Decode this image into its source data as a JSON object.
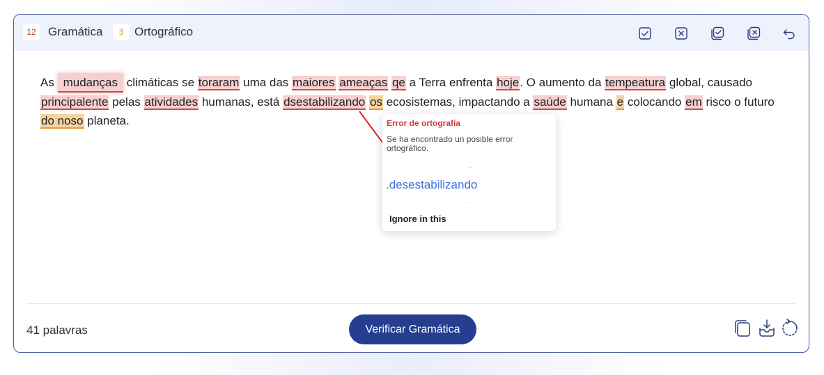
{
  "tabs": [
    {
      "count": "12",
      "label": "Gramática",
      "color": "#d0393b"
    },
    {
      "count": "3",
      "label": "Ortográfico",
      "color": "#e9972f"
    }
  ],
  "toolbar_icons": [
    "check-square-icon",
    "x-square-icon",
    "check-all-icon",
    "x-all-icon",
    "undo-icon"
  ],
  "editor": {
    "words": {
      "as": "As",
      "mudancas": "mudanças",
      "climaticas": "climáticas se",
      "tornaram": "toraram",
      "uma_das": "uma das",
      "maiores": "maiores",
      "ameacas": "ameaças",
      "que": "qe",
      "terra": "a Terra enfrenta",
      "hoje": "hoje",
      "aumento": ". O aumento da",
      "temperatura": "tempeatura",
      "global": "global,",
      "causado": "causado",
      "principalmente": "principalente",
      "pelas": "pelas",
      "atividades": "atividades",
      "humanas": "humanas, está",
      "desestabilizando": "dsestabilizando",
      "os": "os",
      "ecossistemas": "ecosistemas, impactando a",
      "saude": "saúde",
      "humana": "humana",
      "e": "e",
      "colocando": "colocando",
      "em": "em",
      "risco": "risco o futuro",
      "do_nosso": "do noso",
      "planeta": "planeta."
    }
  },
  "popup": {
    "title": "Error de ortografía",
    "description": "Se ha encontrado un posible error ortográfico.",
    "suggestion": ".desestabilizando",
    "ignore": "Ignore in this"
  },
  "footer": {
    "word_count": "41 palavras",
    "check_button": "Verificar Gramática",
    "icons": [
      "copy-icon",
      "download-icon",
      "refresh-icon"
    ]
  },
  "colors": {
    "accent": "#253e8f",
    "error": "#d8464a",
    "warning": "#e59b34",
    "suggestion": "#3d6fe0"
  }
}
